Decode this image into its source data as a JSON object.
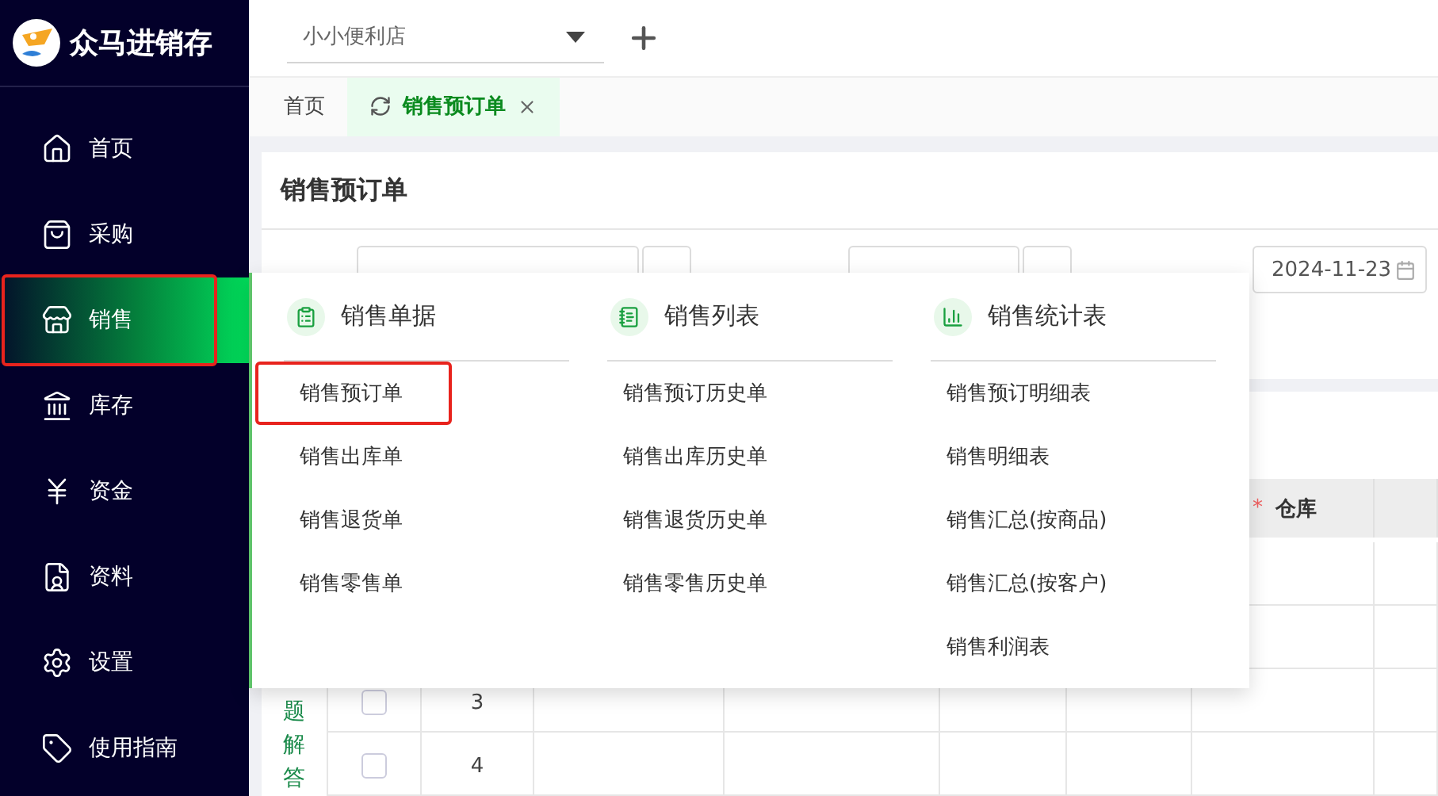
{
  "app": {
    "name": "众马进销存"
  },
  "store_select": {
    "value": "小小便利店"
  },
  "sidebar": {
    "items": [
      {
        "label": "首页",
        "selected": false,
        "highlighted": false
      },
      {
        "label": "采购",
        "selected": false,
        "highlighted": false
      },
      {
        "label": "销售",
        "selected": true,
        "highlighted": true
      },
      {
        "label": "库存",
        "selected": false,
        "highlighted": false
      },
      {
        "label": "资金",
        "selected": false,
        "highlighted": false
      },
      {
        "label": "资料",
        "selected": false,
        "highlighted": false
      },
      {
        "label": "设置",
        "selected": false,
        "highlighted": false
      },
      {
        "label": "使用指南",
        "selected": false,
        "highlighted": false
      }
    ]
  },
  "tabs": [
    {
      "label": "首页",
      "selected": false,
      "closable": false
    },
    {
      "label": "销售预订单",
      "selected": true,
      "closable": true
    }
  ],
  "page": {
    "title": "销售预订单",
    "date_field": {
      "value": "2024-11-23"
    }
  },
  "side_text": "题解答",
  "table": {
    "columns": [
      {
        "label": "仓库",
        "required_mark": "*"
      }
    ],
    "rows": [
      {
        "number": "3",
        "checked": false
      },
      {
        "number": "4",
        "checked": false
      }
    ]
  },
  "menu": {
    "columns": [
      {
        "title": "销售单据",
        "items": [
          {
            "label": "销售预订单",
            "highlighted": true
          },
          {
            "label": "销售出库单",
            "highlighted": false
          },
          {
            "label": "销售退货单",
            "highlighted": false
          },
          {
            "label": "销售零售单",
            "highlighted": false
          }
        ]
      },
      {
        "title": "销售列表",
        "items": [
          {
            "label": "销售预订历史单",
            "highlighted": false
          },
          {
            "label": "销售出库历史单",
            "highlighted": false
          },
          {
            "label": "销售退货历史单",
            "highlighted": false
          },
          {
            "label": "销售零售历史单",
            "highlighted": false
          }
        ]
      },
      {
        "title": "销售统计表",
        "items": [
          {
            "label": "销售预订明细表",
            "highlighted": false
          },
          {
            "label": "销售明细表",
            "highlighted": false
          },
          {
            "label": "销售汇总(按商品)",
            "highlighted": false
          },
          {
            "label": "销售汇总(按客户)",
            "highlighted": false
          },
          {
            "label": "销售利润表",
            "highlighted": false
          }
        ]
      }
    ]
  }
}
